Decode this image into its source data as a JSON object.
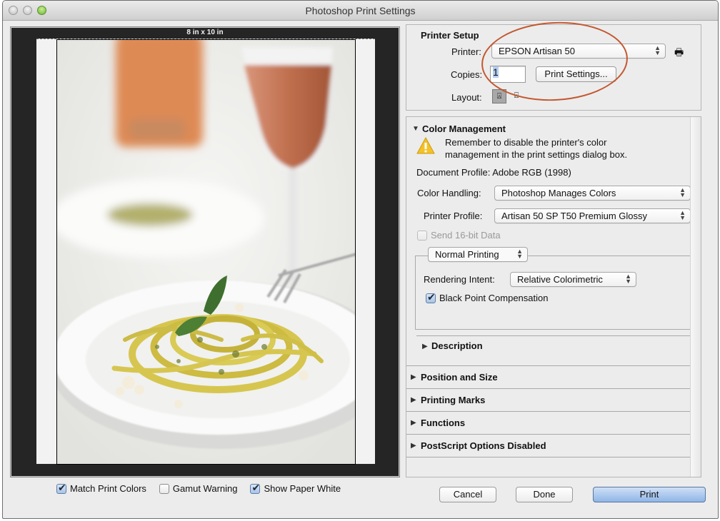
{
  "window": {
    "title": "Photoshop Print Settings",
    "traffic_lights": [
      "close",
      "minimize",
      "zoom"
    ]
  },
  "preview": {
    "paper_size": "8 in x 10 in",
    "image_description": "Plate of spaghetti with pesto and basil leaf, blurred rosé wine glass, bottle and olives in background",
    "options": [
      {
        "label": "Match Print Colors",
        "checked": true
      },
      {
        "label": "Gamut Warning",
        "checked": false
      },
      {
        "label": "Show Paper White",
        "checked": true
      }
    ]
  },
  "printer_setup": {
    "title": "Printer Setup",
    "printer_label": "Printer:",
    "printer_value": "EPSON Artisan 50",
    "add_printer_icon": "printer-add-icon",
    "copies_label": "Copies:",
    "copies_value": "1",
    "print_settings_button": "Print Settings...",
    "layout_label": "Layout:",
    "layout_options": [
      {
        "name": "portrait",
        "selected": true
      },
      {
        "name": "landscape",
        "selected": false
      }
    ]
  },
  "color_management": {
    "title": "Color Management",
    "expanded": true,
    "warning_text_line1": "Remember to disable the printer's color",
    "warning_text_line2": "management in the print settings dialog box.",
    "document_profile": "Document Profile: Adobe RGB (1998)",
    "color_handling_label": "Color Handling:",
    "color_handling_value": "Photoshop Manages Colors",
    "printer_profile_label": "Printer Profile:",
    "printer_profile_value": "Artisan 50 SP T50 Premium Glossy",
    "send_16bit_label": "Send 16-bit Data",
    "send_16bit_checked": false,
    "send_16bit_enabled": false,
    "printing_mode_value": "Normal Printing",
    "rendering_intent_label": "Rendering Intent:",
    "rendering_intent_value": "Relative Colorimetric",
    "black_point_label": "Black Point Compensation",
    "black_point_checked": true,
    "description_label": "Description"
  },
  "collapsed_sections": [
    {
      "label": "Position and Size"
    },
    {
      "label": "Printing Marks"
    },
    {
      "label": "Functions"
    },
    {
      "label": "PostScript Options Disabled"
    }
  ],
  "buttons": {
    "cancel": "Cancel",
    "done": "Done",
    "print": "Print"
  },
  "colors": {
    "annotation_ellipse": "#c4572f",
    "primary_button": "#8fb5e6",
    "preview_background": "#252525"
  }
}
